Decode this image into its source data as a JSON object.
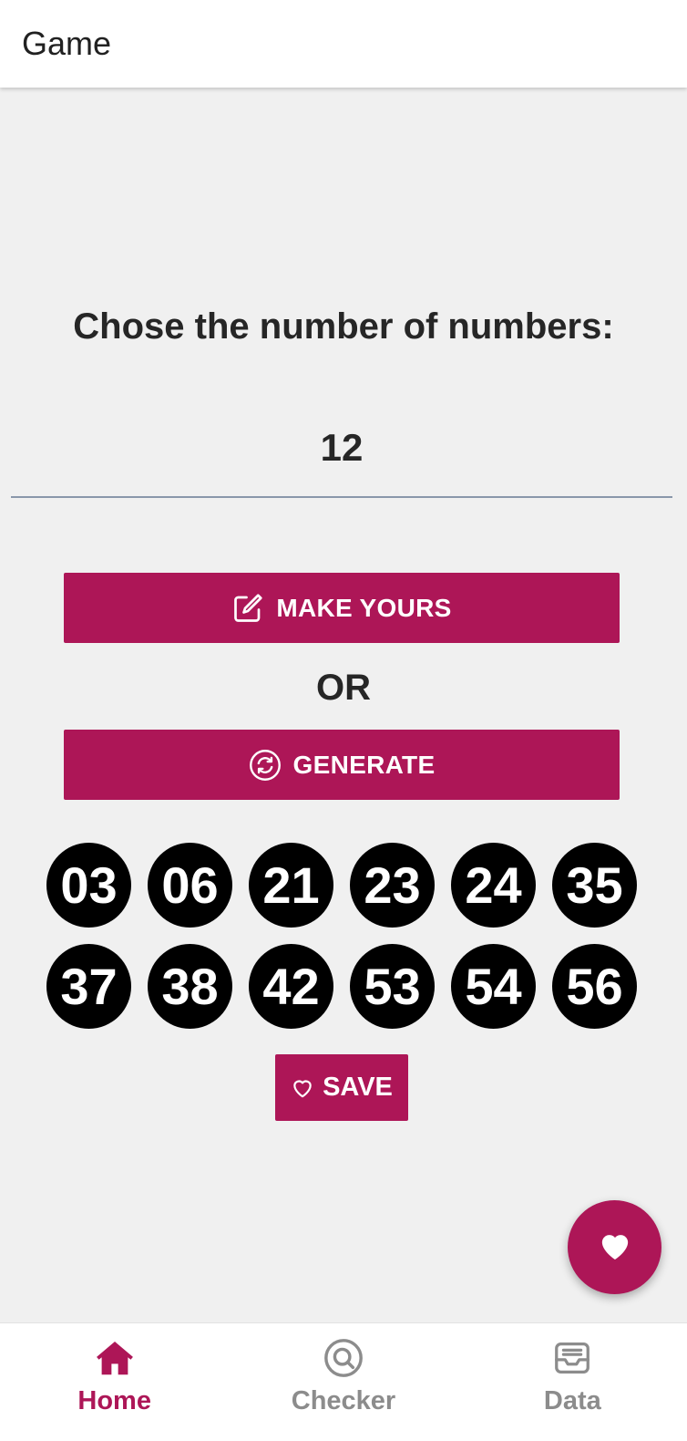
{
  "app_bar": {
    "title": "Game"
  },
  "main": {
    "prompt": "Chose the number of numbers:",
    "count_value": "12",
    "make_yours_label": "MAKE YOURS",
    "or_label": "OR",
    "generate_label": "GENERATE",
    "numbers": [
      "03",
      "06",
      "21",
      "23",
      "24",
      "35",
      "37",
      "38",
      "42",
      "53",
      "54",
      "56"
    ],
    "save_label": "SAVE"
  },
  "fab": {
    "icon": "heart-icon"
  },
  "bottom_nav": {
    "items": [
      {
        "label": "Home",
        "icon": "home-icon",
        "active": true
      },
      {
        "label": "Checker",
        "icon": "search-circle-icon",
        "active": false
      },
      {
        "label": "Data",
        "icon": "inbox-icon",
        "active": false
      }
    ]
  },
  "colors": {
    "accent": "#ad1657",
    "background": "#f0f0f0",
    "ball": "#000000",
    "inactive": "#8c8c8c"
  }
}
